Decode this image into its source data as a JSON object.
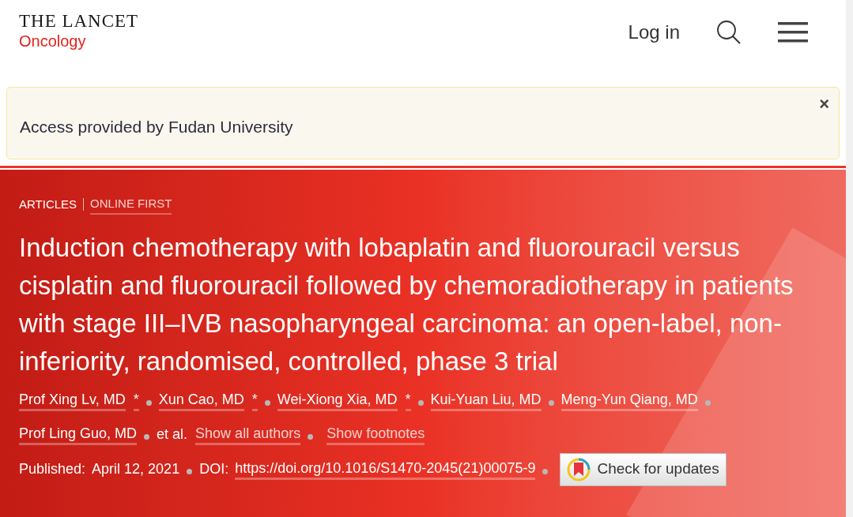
{
  "header": {
    "logo_title": "THE LANCET",
    "logo_subtitle": "Oncology",
    "login": "Log in"
  },
  "access_banner": {
    "text": "Access provided by Fudan University",
    "close": "×"
  },
  "article": {
    "type": "ARTICLES",
    "status": "ONLINE FIRST",
    "title": "Induction chemotherapy with lobaplatin and fluorouracil versus cisplatin and fluorouracil followed by chemoradiotherapy in patients with stage III–IVB nasopharyngeal carcinoma: an open-label, non-inferiority, randomised, controlled, phase 3 trial",
    "authors": [
      {
        "name": "Prof Xing Lv, MD",
        "footnote": "*"
      },
      {
        "name": "Xun Cao, MD",
        "footnote": "*"
      },
      {
        "name": "Wei-Xiong Xia, MD",
        "footnote": "*"
      },
      {
        "name": "Kui-Yuan Liu, MD"
      },
      {
        "name": "Meng-Yun Qiang, MD"
      },
      {
        "name": "Prof Ling Guo, MD"
      }
    ],
    "et_al": "et al.",
    "show_all_authors": "Show all authors",
    "show_footnotes": "Show footnotes",
    "published_label": "Published:",
    "published_date": "April 12, 2021",
    "doi_label": "DOI:",
    "doi": "https://doi.org/10.1016/S1470-2045(21)00075-9",
    "check_updates": "Check for updates"
  }
}
